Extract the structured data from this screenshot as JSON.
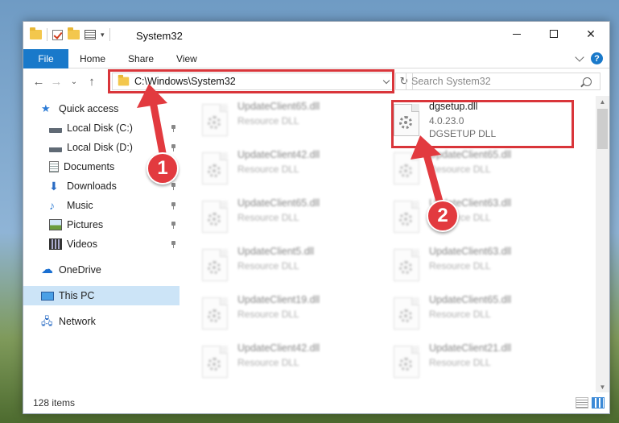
{
  "window": {
    "title": "System32",
    "controls": {
      "minimize": "",
      "maximize": "",
      "close": "✕"
    }
  },
  "ribbon": {
    "tabs": [
      "File",
      "Home",
      "Share",
      "View"
    ],
    "help": "?"
  },
  "nav": {
    "back": "←",
    "forward": "→",
    "recent": "⌄",
    "up": "↑",
    "address": "C:\\Windows\\System32",
    "refresh": "↻",
    "search_placeholder": "Search System32"
  },
  "sidebar": {
    "items": [
      {
        "label": "Quick access",
        "icon": "star-icon",
        "pinned": false
      },
      {
        "label": "Local Disk (C:)",
        "icon": "drive-icon",
        "pinned": true
      },
      {
        "label": "Local Disk (D:)",
        "icon": "drive-icon",
        "pinned": true
      },
      {
        "label": "Documents",
        "icon": "documents-icon",
        "pinned": true
      },
      {
        "label": "Downloads",
        "icon": "downloads-icon",
        "pinned": true
      },
      {
        "label": "Music",
        "icon": "music-icon",
        "pinned": true
      },
      {
        "label": "Pictures",
        "icon": "pictures-icon",
        "pinned": true
      },
      {
        "label": "Videos",
        "icon": "videos-icon",
        "pinned": true
      },
      {
        "label": "OneDrive",
        "icon": "cloud-icon",
        "pinned": false
      },
      {
        "label": "This PC",
        "icon": "computer-icon",
        "pinned": false,
        "selected": true
      },
      {
        "label": "Network",
        "icon": "network-icon",
        "pinned": false
      }
    ]
  },
  "files": {
    "left_column": [
      {
        "name": "UpdateClient65.dll",
        "desc": "Resource DLL"
      },
      {
        "name": "UpdateClient42.dll",
        "desc": "Resource DLL"
      },
      {
        "name": "UpdateClient65.dll",
        "desc": "Resource DLL"
      },
      {
        "name": "UpdateClient5.dll",
        "desc": "Resource DLL"
      },
      {
        "name": "UpdateClient19.dll",
        "desc": "Resource DLL"
      },
      {
        "name": "UpdateClient42.dll",
        "desc": "Resource DLL"
      }
    ],
    "highlighted": {
      "name": "dgsetup.dll",
      "version": "4.0.23.0",
      "desc": "DGSETUP DLL"
    },
    "right_column": [
      {
        "name": "UpdateClient65.dll",
        "desc": "Resource DLL"
      },
      {
        "name": "UpdateClient63.dll",
        "desc": "Resource DLL"
      },
      {
        "name": "UpdateClient63.dll",
        "desc": "Resource DLL"
      },
      {
        "name": "UpdateClient65.dll",
        "desc": "Resource DLL"
      },
      {
        "name": "UpdateClient21.dll",
        "desc": "Resource DLL"
      }
    ]
  },
  "status": {
    "count": "128 items"
  },
  "annotations": {
    "step1": "1",
    "step2": "2",
    "color": "#e23a3f"
  }
}
